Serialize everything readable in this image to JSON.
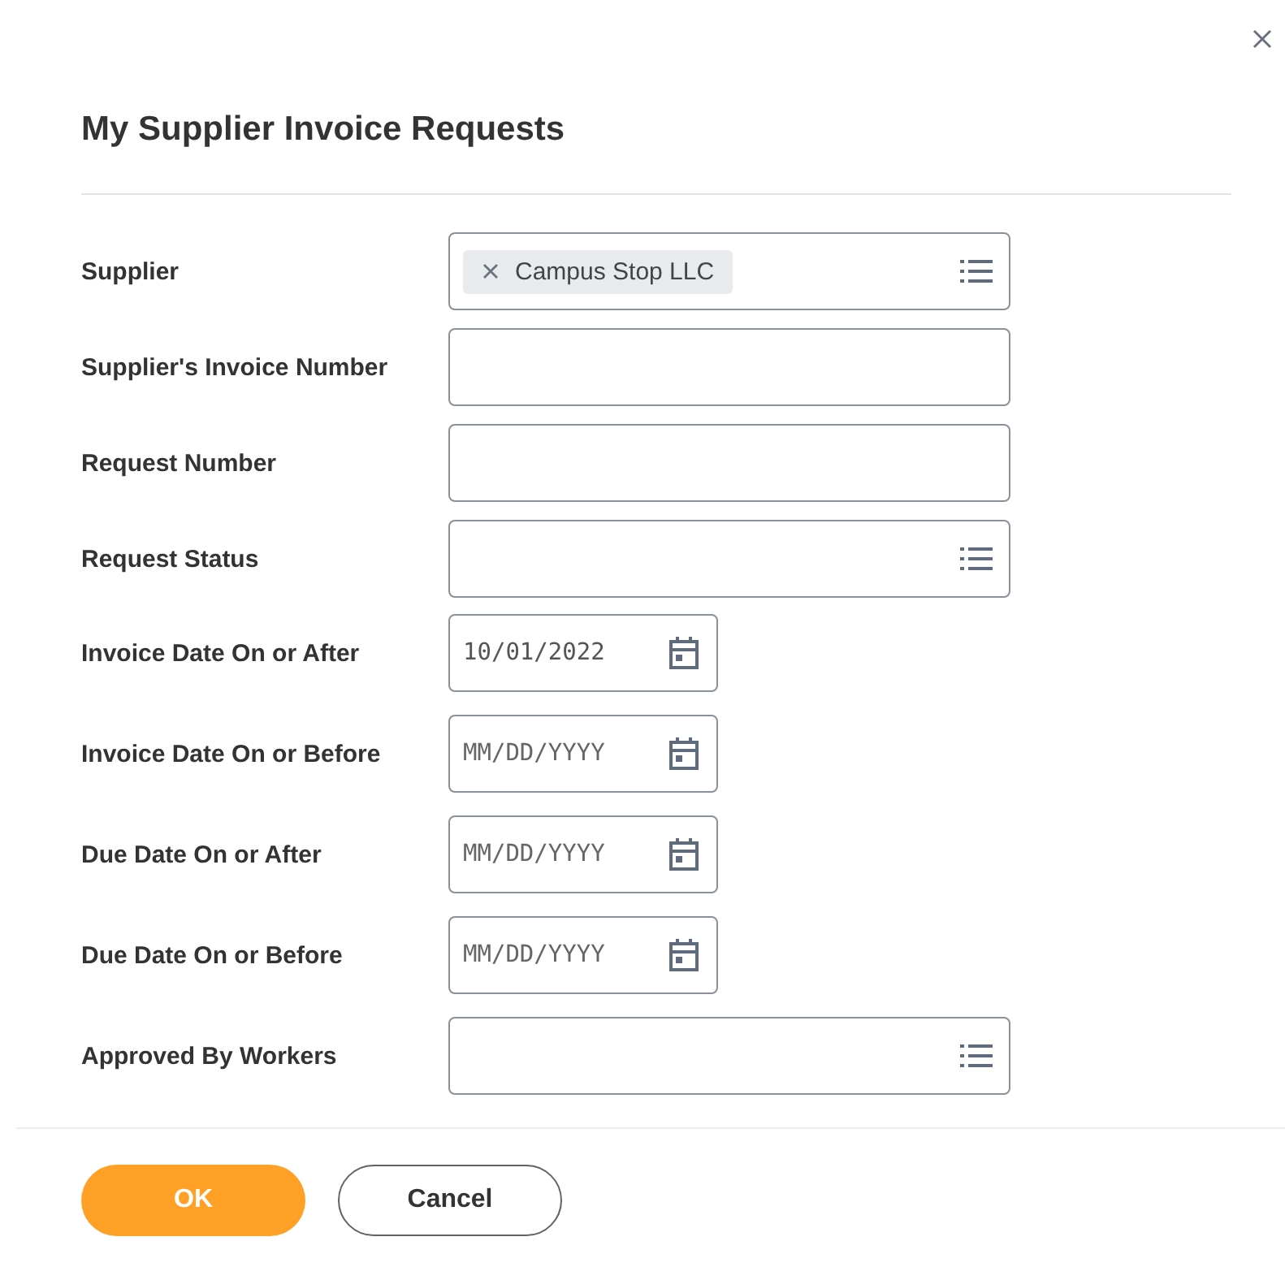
{
  "dialog": {
    "title": "My Supplier Invoice Requests"
  },
  "fields": [
    {
      "label": "Supplier",
      "kind": "prompt",
      "tokens": [
        "Campus Stop LLC"
      ]
    },
    {
      "label": "Supplier's Invoice Number",
      "kind": "text"
    },
    {
      "label": "Request Number",
      "kind": "text"
    },
    {
      "label": "Request Status",
      "kind": "prompt"
    },
    {
      "label": "Invoice Date On or After",
      "kind": "date",
      "value": "10/01/2022"
    },
    {
      "label": "Invoice Date On or Before",
      "kind": "date",
      "placeholder": "MM/DD/YYYY"
    },
    {
      "label": "Due Date On or After",
      "kind": "date",
      "placeholder": "MM/DD/YYYY"
    },
    {
      "label": "Due Date On or Before",
      "kind": "date",
      "placeholder": "MM/DD/YYYY"
    },
    {
      "label": "Approved By Workers",
      "kind": "prompt"
    }
  ],
  "buttons": [
    {
      "label": "OK",
      "kind": "primary"
    },
    {
      "label": "Cancel",
      "kind": "secondary"
    }
  ]
}
